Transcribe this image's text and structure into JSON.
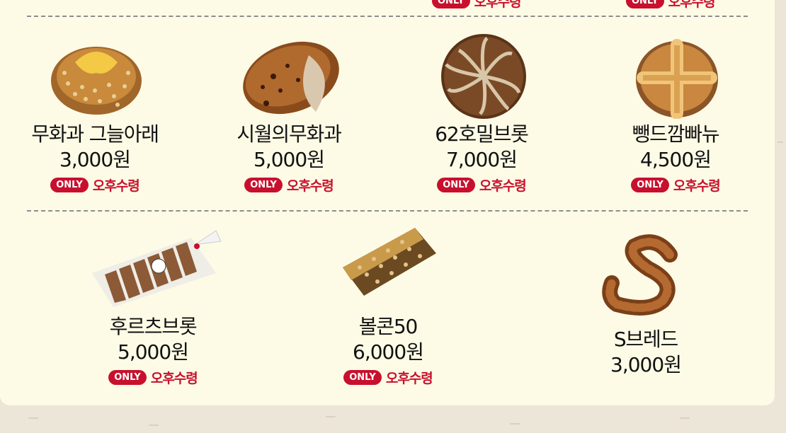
{
  "only_badge": "ONLY",
  "pickup_label": "오후수령",
  "row1": [
    {
      "name": "무화과 그늘아래",
      "price": "3,000원"
    },
    {
      "name": "시월의무화과",
      "price": "5,000원"
    },
    {
      "name": "62호밀브롯",
      "price": "7,000원"
    },
    {
      "name": "뺑드깜빠뉴",
      "price": "4,500원"
    }
  ],
  "row2": [
    {
      "name": "후르츠브롯",
      "price": "5,000원"
    },
    {
      "name": "볼콘50",
      "price": "6,000원"
    },
    {
      "name": "S브레드",
      "price": "3,000원"
    }
  ]
}
